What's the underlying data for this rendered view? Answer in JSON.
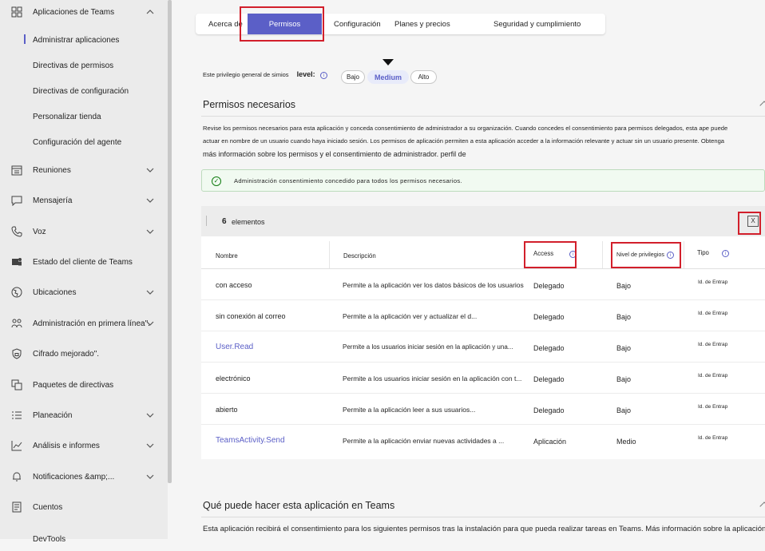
{
  "sidebar": {
    "group": {
      "label": "Aplicaciones de Teams"
    },
    "sub_items": [
      {
        "label": "Administrar aplicaciones"
      },
      {
        "label": "Directivas de permisos"
      },
      {
        "label": "Directivas de configuración"
      },
      {
        "label": "Personalizar tienda"
      },
      {
        "label": "Configuración del agente"
      }
    ],
    "items": [
      {
        "label": "Reuniones"
      },
      {
        "label": "Mensajería"
      },
      {
        "label": "Voz"
      },
      {
        "label": "Estado del cliente de Teams"
      },
      {
        "label": "Ubicaciones"
      },
      {
        "label": "Administración en primera línea\"."
      },
      {
        "label": "Cifrado mejorado\"."
      },
      {
        "label": "Paquetes de directivas"
      },
      {
        "label": "Planeación"
      },
      {
        "label": "Análisis e informes"
      },
      {
        "label": "Notificaciones &amp;..."
      },
      {
        "label": "Cuentos"
      },
      {
        "label": "DevTools"
      }
    ]
  },
  "tabs": [
    {
      "label": "Acerca de"
    },
    {
      "label": "Permisos"
    },
    {
      "label": "Configuración"
    },
    {
      "label": "Planes y precios"
    },
    {
      "label": "Seguridad y cumplimiento"
    }
  ],
  "privilege": {
    "text": "Este privilegio general de simios",
    "level_label": "level:",
    "options": [
      "Bajo",
      "Medium",
      "Alto"
    ],
    "selected": "Medium"
  },
  "permissions_section": {
    "title": "Permisos necesarios",
    "description_1": "Revise los permisos necesarios para esta aplicación y conceda consentimiento de administrador a su organización. Cuando concedes el consentimiento para permisos delegados, esta ape puede",
    "description_2": "actuar en nombre de un usuario cuando haya iniciado sesión. Los permisos de aplicación permiten a esta aplicación acceder a la información relevante y actuar sin un usuario presente. Obtenga",
    "description_3": "más información sobre los permisos y el consentimiento de administrador. perfil de",
    "banner": "Administración consentimiento concedido para todos los permisos necesarios.",
    "count": "6",
    "count_label": "elementos"
  },
  "table": {
    "headers": {
      "name": "Nombre",
      "description": "Descripción",
      "access": "Access",
      "level": "Nivel de privilegios",
      "type": "Tipo"
    },
    "rows": [
      {
        "name": "con acceso",
        "description": "Permite a la aplicación ver los datos básicos de los usuarios",
        "access": "Delegado",
        "level": "Bajo",
        "type": "Id. de Entrap"
      },
      {
        "name": "sin conexión al correo",
        "description": "Permite a la aplicación ver y actualizar el d...",
        "access": "Delegado",
        "level": "Bajo",
        "type": "Id. de Entrap"
      },
      {
        "name": "User.Read",
        "description": "Permite a los usuarios iniciar sesión en la aplicación y una...",
        "access": "Delegado",
        "level": "Bajo",
        "type": "Id. de Entrap"
      },
      {
        "name": "electrónico",
        "description": "Permite a los usuarios iniciar sesión en la aplicación con t...",
        "access": "Delegado",
        "level": "Bajo",
        "type": "Id. de Entrap"
      },
      {
        "name": "abierto",
        "description": "Permite a la aplicación leer a sus usuarios...",
        "access": "Delegado",
        "level": "Bajo",
        "type": "Id. de Entrap"
      },
      {
        "name": "TeamsActivity.Send",
        "description": "Permite a la aplicación enviar nuevas actividades a ...",
        "access": "Aplicación",
        "level": "Medio",
        "type": "Id. de Entrap"
      }
    ]
  },
  "capabilities_section": {
    "title": "Qué puede hacer esta aplicación en Teams",
    "description": "Esta aplicación recibirá el consentimiento para los siguientes permisos tras la instalación para que pueda realizar tareas en Teams. Más información sobre la aplicación"
  },
  "colors": {
    "accent": "#5b5fc7",
    "highlight_box": "#d21f2b",
    "success": "#107c10"
  }
}
